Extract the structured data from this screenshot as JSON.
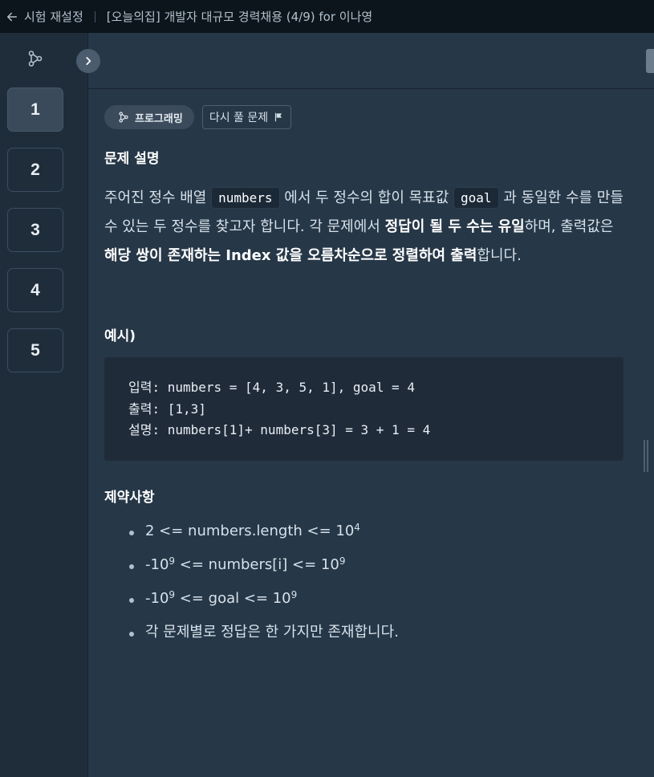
{
  "topbar": {
    "back_label": "시험 재설정",
    "title": "[오늘의집] 개발자 대규모 경력채용 (4/9) for 이나영"
  },
  "sidebar": {
    "questions": [
      "1",
      "2",
      "3",
      "4",
      "5"
    ],
    "active_index": 0
  },
  "problem": {
    "tag_label": "프로그래밍",
    "retry_label": "다시 풀 문제",
    "section_desc_title": "문제 설명",
    "desc": {
      "p1": "주어진 정수 배열 ",
      "code1": "numbers",
      "p2": " 에서 두 정수의 합이 목표값 ",
      "code2": "goal",
      "p3": " 과 동일한 수를 만들 수 있는 두 정수를 찾고자 합니다. 각 문제에서 ",
      "b1": "정답이 될 두 수는 유일",
      "p4": "하며, 출력값은 ",
      "b2": "해당 쌍이 존재하는 Index 값을 오름차순으로 정렬하여 출력",
      "p5": "합니다."
    },
    "section_example_title": "예시)",
    "example_lines": [
      "입력: numbers = [4, 3, 5, 1], goal = 4",
      "출력: [1,3]",
      "설명: numbers[1]+ numbers[3] = 3 + 1 = 4"
    ],
    "section_constraints_title": "제약사항",
    "constraints": {
      "c1_text": "2 <= numbers.length <= 10",
      "c1_sup": "4",
      "c2_pre": "-10",
      "c2_sup1": "9",
      "c2_mid": " <= numbers[i] <= 10",
      "c2_sup2": "9",
      "c3_pre": "-10",
      "c3_sup1": "9",
      "c3_mid": " <= goal <= 10",
      "c3_sup2": "9",
      "c4_text": "각 문제별로 정답은 한 가지만 존재합니다."
    }
  },
  "colors": {
    "topbar_bg": "#0c151c",
    "sidebar_bg": "#1f2d3b",
    "main_bg": "#263747",
    "code_bg": "#202b3a"
  }
}
